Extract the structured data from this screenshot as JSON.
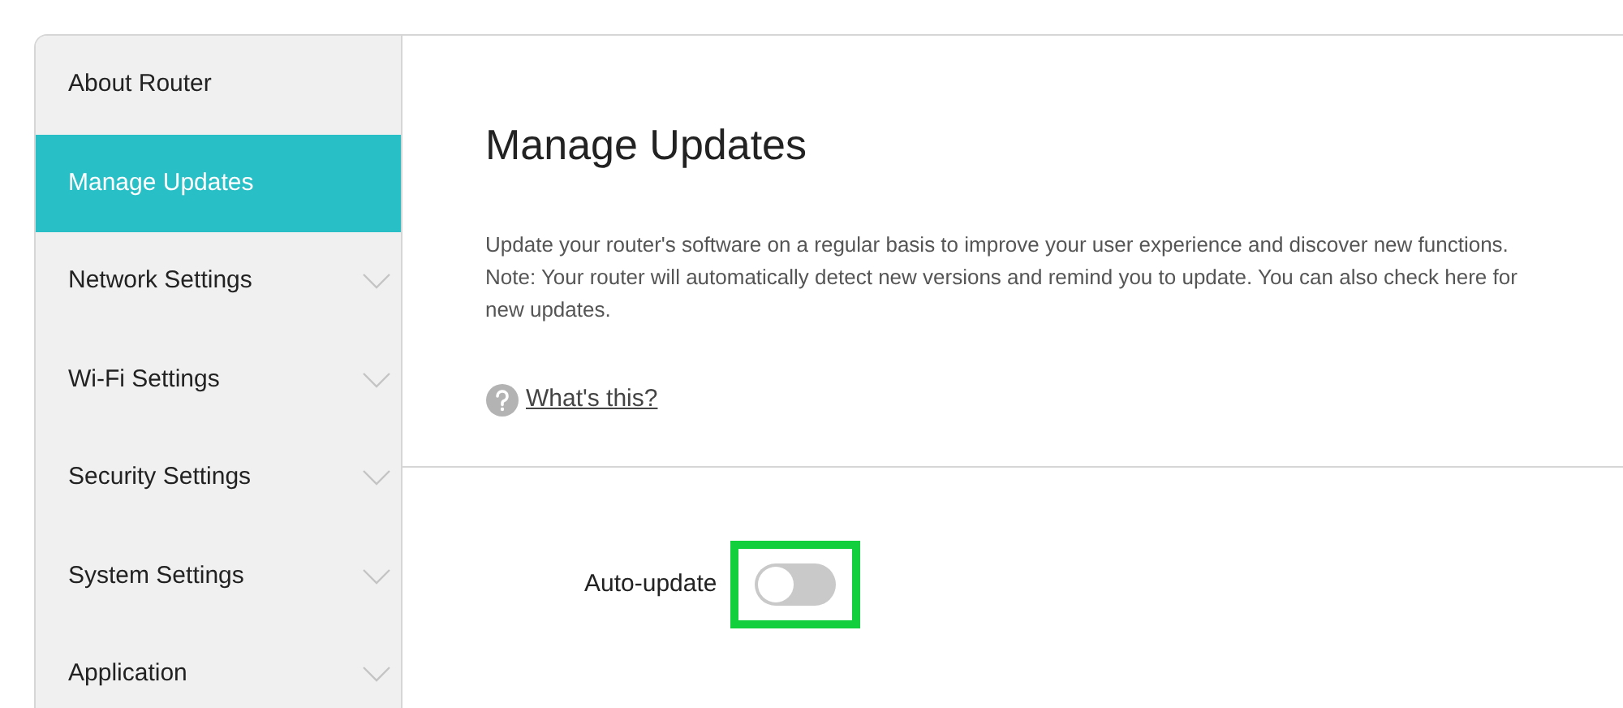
{
  "sidebar": {
    "items": [
      {
        "label": "About Router",
        "selected": false,
        "expandable": false
      },
      {
        "label": "Manage Updates",
        "selected": true,
        "expandable": false
      },
      {
        "label": "Network Settings",
        "selected": false,
        "expandable": true
      },
      {
        "label": "Wi-Fi Settings",
        "selected": false,
        "expandable": true
      },
      {
        "label": "Security Settings",
        "selected": false,
        "expandable": true
      },
      {
        "label": "System Settings",
        "selected": false,
        "expandable": true
      },
      {
        "label": "Application",
        "selected": false,
        "expandable": true
      }
    ]
  },
  "page": {
    "title": "Manage Updates",
    "description": "Update your router's software on a regular basis to improve your user experience and discover new functions.",
    "note": "Note: Your router will automatically detect new versions and remind you to update. You can also check here for new updates.",
    "help_link": "What's this?"
  },
  "settings": [
    {
      "label": "Auto-update",
      "on": false,
      "highlighted": true
    }
  ]
}
